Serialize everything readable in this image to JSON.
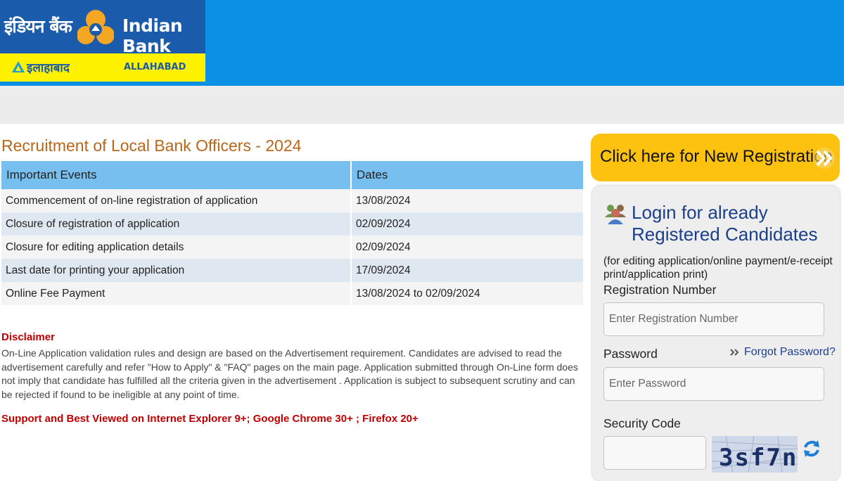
{
  "header": {
    "logo_hindi": "इंडियन बैंक",
    "logo_english": "Indian Bank",
    "logo_allahabad_hindi": "इलाहाबाद",
    "logo_allahabad_english": "ALLAHABAD"
  },
  "main": {
    "title": "Recruitment of Local Bank Officers - 2024",
    "table": {
      "headers": [
        "Important Events",
        "Dates"
      ],
      "rows": [
        [
          "Commencement of on-line registration of application",
          "13/08/2024"
        ],
        [
          "Closure of registration of application",
          "02/09/2024"
        ],
        [
          "Closure for editing application details",
          "02/09/2024"
        ],
        [
          "Last date for printing your application",
          "17/09/2024"
        ],
        [
          "Online Fee Payment",
          "13/08/2024 to 02/09/2024"
        ]
      ]
    },
    "disclaimer_title": "Disclaimer",
    "disclaimer_text": "On-Line Application validation rules and design are based on the Advertisement requirement. Candidates are advised to read the advertisement carefully and refer \"How to Apply\" & \"FAQ\" pages on the main page. Application submitted through On-Line form does not imply that candidate has fulfilled all the criteria given in the advertisement . Application is subject to subsequent scrutiny and can be rejected if found to be ineligible at any point of time.",
    "support_text": "Support and Best Viewed on Internet Explorer 9+; Google Chrome 30+ ; Firefox 20+"
  },
  "sidebar": {
    "register_label": "Click here for New Registration",
    "login_title": "Login for already Registered Candidates",
    "login_note": "(for editing application/online payment/e-receipt print/application print)",
    "reg_number_label": "Registration Number",
    "reg_number_placeholder": "Enter Registration Number",
    "password_label": "Password",
    "forgot_label": "Forgot Password?",
    "password_placeholder": "Enter Password",
    "security_label": "Security Code",
    "captcha_text": "3sf7n"
  },
  "colors": {
    "header_blue": "#0a90e4",
    "title_orange": "#b8661a",
    "table_header": "#76bfee",
    "disclaimer_red": "#c00000",
    "button_yellow": "#fdc210",
    "login_blue": "#1c3f8c"
  },
  "icons": {
    "logo_emblem": "indian-bank-emblem-icon",
    "register_arrow": "double-chevron-right-icon",
    "login_users": "users-icon",
    "forgot_arrow": "double-chevron-right-icon",
    "captcha_refresh": "refresh-icon"
  }
}
